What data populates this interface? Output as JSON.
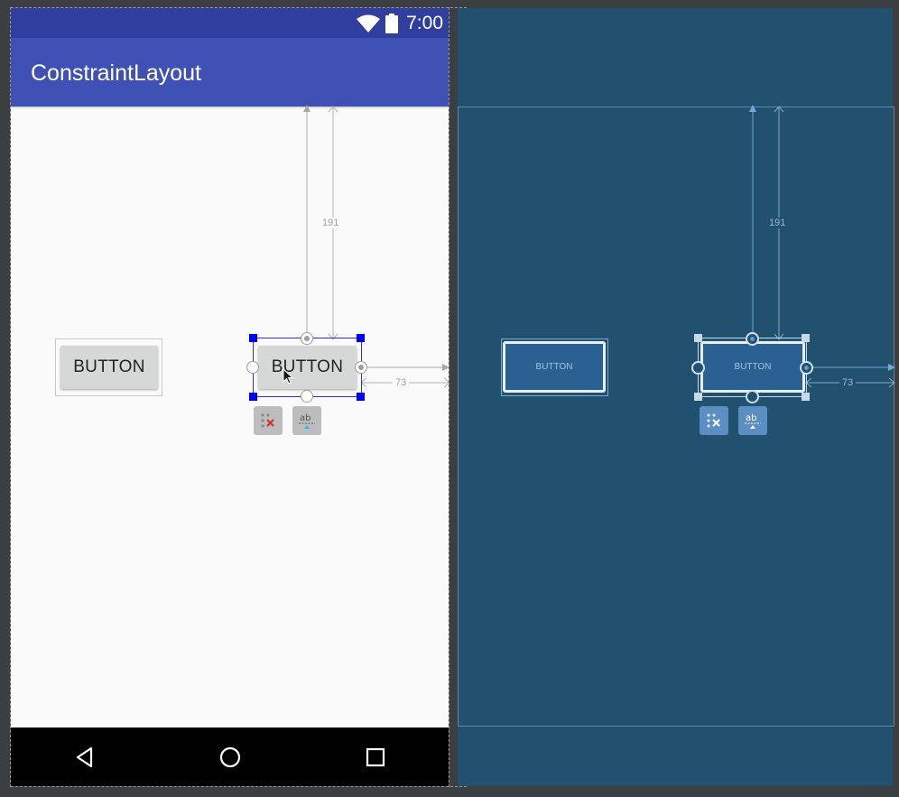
{
  "status_bar": {
    "time": "7:00",
    "wifi_icon": "wifi-icon",
    "battery_icon": "battery-icon"
  },
  "app_bar": {
    "title": "ConstraintLayout"
  },
  "design": {
    "button_left_label": "BUTTON",
    "button_selected_label": "BUTTON",
    "margin_top": "191",
    "margin_right": "73",
    "clear_constraints_icon": "clear-constraints-icon",
    "baseline_icon": "baseline-icon"
  },
  "blueprint": {
    "button_left_label": "BUTTON",
    "button_selected_label": "BUTTON",
    "margin_top": "191",
    "margin_right": "73"
  },
  "nav_bar": {
    "back_icon": "back-icon",
    "home_icon": "home-icon",
    "recents_icon": "recents-icon"
  },
  "colors": {
    "status_bar": "#303f9f",
    "app_bar": "#3f51b5",
    "blueprint": "#22506f",
    "selection": "#0000ff",
    "editor_bg": "#3c3f41"
  }
}
